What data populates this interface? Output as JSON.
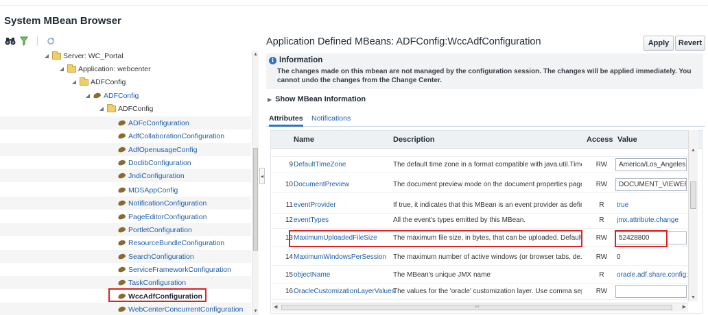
{
  "page": {
    "title": "System MBean Browser"
  },
  "tree": {
    "items": [
      {
        "label": "Server: WC_Portal",
        "type": "folder",
        "expanded": true,
        "style": "plain"
      },
      {
        "label": "Application: webcenter",
        "type": "folder",
        "expanded": true,
        "style": "plain"
      },
      {
        "label": "ADFConfig",
        "type": "folder",
        "expanded": true,
        "style": "plain"
      },
      {
        "label": "ADFConfig",
        "type": "bean",
        "expanded": true,
        "style": "link"
      },
      {
        "label": "ADFConfig",
        "type": "folder",
        "expanded": true,
        "style": "plain"
      },
      {
        "label": "ADFcConfiguration",
        "type": "bean",
        "style": "link"
      },
      {
        "label": "AdfCollaborationConfiguration",
        "type": "bean",
        "style": "link"
      },
      {
        "label": "AdfOpenusageConfig",
        "type": "bean",
        "style": "link"
      },
      {
        "label": "DoclibConfiguration",
        "type": "bean",
        "style": "link"
      },
      {
        "label": "JndiConfiguration",
        "type": "bean",
        "style": "link"
      },
      {
        "label": "MDSAppConfig",
        "type": "bean",
        "style": "link"
      },
      {
        "label": "NotificationConfiguration",
        "type": "bean",
        "style": "link"
      },
      {
        "label": "PageEditorConfiguration",
        "type": "bean",
        "style": "link"
      },
      {
        "label": "PortletConfiguration",
        "type": "bean",
        "style": "link"
      },
      {
        "label": "ResourceBundleConfiguration",
        "type": "bean",
        "style": "link"
      },
      {
        "label": "SearchConfiguration",
        "type": "bean",
        "style": "link"
      },
      {
        "label": "ServiceFrameworkConfiguration",
        "type": "bean",
        "style": "link"
      },
      {
        "label": "TaskConfiguration",
        "type": "bean",
        "style": "link"
      },
      {
        "label": "WccAdfConfiguration",
        "type": "bean",
        "style": "selected"
      },
      {
        "label": "WebCenterConcurrentConfiguration",
        "type": "bean",
        "style": "link"
      }
    ]
  },
  "header": {
    "title": "Application Defined MBeans: ADFConfig:WccAdfConfiguration",
    "apply_label": "Apply",
    "revert_label": "Revert"
  },
  "info": {
    "heading": "Information",
    "body": "The changes made on this mbean are not managed by the configuration session. The changes will be applied immediately. You cannot undo the changes from the Change Center."
  },
  "show_mbean_info": "Show MBean Information",
  "tabs": [
    {
      "label": "Attributes"
    },
    {
      "label": "Notifications"
    }
  ],
  "table": {
    "columns": {
      "name": "Name",
      "description": "Description",
      "access": "Access",
      "value": "Value"
    },
    "rows": [
      {
        "num": "9",
        "name": "DefaultTimeZone",
        "desc": "The default time zone in a format compatible with java.util.Time...",
        "access": "RW",
        "value": "America/Los_Angeles",
        "value_kind": "input"
      },
      {
        "num": "10",
        "name": "DocumentPreview",
        "desc": "The document preview mode on the document properties page...",
        "access": "RW",
        "value": "DOCUMENT_VIEWER",
        "value_kind": "input"
      },
      {
        "num": "11",
        "name": "eventProvider",
        "desc": "If true, it indicates that this MBean is an event provider as defin...",
        "access": "R",
        "value": "true",
        "value_kind": "link"
      },
      {
        "num": "12",
        "name": "eventTypes",
        "desc": "All the event's types emitted by this MBean.",
        "access": "R",
        "value": "jmx.attribute.change",
        "value_kind": "link"
      },
      {
        "num": "13",
        "name": "MaximumUploadedFileSize",
        "desc": "The maximum file size, in bytes, that can be uploaded. Default: ...",
        "access": "RW",
        "value": "52428800",
        "value_kind": "input"
      },
      {
        "num": "14",
        "name": "MaximumWindowsPerSession",
        "desc": "The maximum number of active windows (or browser tabs, de...",
        "access": "RW",
        "value": "0",
        "value_kind": "text"
      },
      {
        "num": "15",
        "name": "objectName",
        "desc": "The MBean's unique JMX name",
        "access": "R",
        "value": "oracle.adf.share.config:A",
        "value_kind": "link"
      },
      {
        "num": "16",
        "name": "OracleCustomizationLayerValues",
        "desc": "The values for the 'oracle' customization layer. Use comma sep...",
        "access": "RW",
        "value": "",
        "value_kind": "input"
      }
    ]
  },
  "colors": {
    "link": "#1d5ea8",
    "highlight": "#e02020",
    "accent": "#2a73c4"
  }
}
